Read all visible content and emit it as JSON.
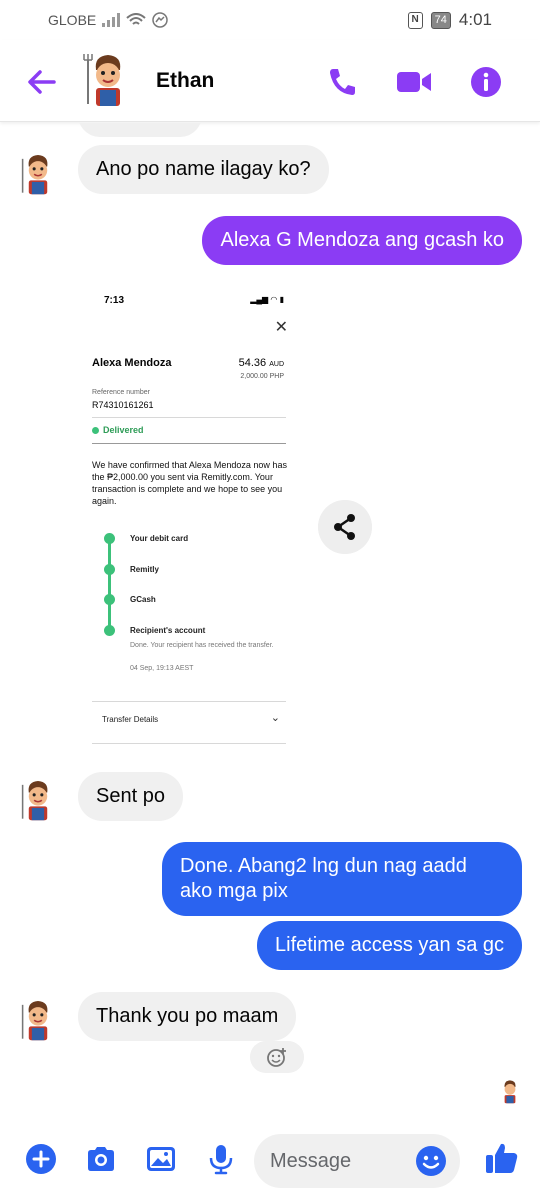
{
  "status_bar": {
    "carrier": "GLOBE",
    "battery": "74",
    "time": "4:01"
  },
  "header": {
    "contact_name": "Ethan"
  },
  "colors": {
    "accent": "#8b3cf4",
    "outgoing_blue": "#2a63f0",
    "incoming_gray": "#f0f0f0"
  },
  "messages": {
    "m1": "Ano po name ilagay ko?",
    "m2": "Alexa G Mendoza ang gcash ko",
    "m3": "Sent po",
    "m4": "Done. Abang2 lng dun nag aadd ako mga pix",
    "m5": "Lifetime access yan sa gc",
    "m6": "Thank you po maam"
  },
  "receipt": {
    "time": "7:13",
    "recipient": "Alexa Mendoza",
    "amount": "54.36",
    "currency": "AUD",
    "amount_php": "2,000.00 PHP",
    "reference_label": "Reference number",
    "reference": "R74310161261",
    "status": "Delivered",
    "confirmation": "We have confirmed that Alexa Mendoza now has the ₱2,000.00 you sent via Remitly.com. Your transaction is complete and we hope to see you again.",
    "steps": [
      "Your debit card",
      "Remitly",
      "GCash",
      "Recipient's account"
    ],
    "done_text": "Done. Your recipient has received the transfer.",
    "date": "04 Sep, 19:13 AEST",
    "transfer_details": "Transfer Details"
  },
  "composer": {
    "placeholder": "Message"
  },
  "icons": [
    "back-arrow-icon",
    "phone-icon",
    "video-icon",
    "info-icon",
    "share-icon",
    "add-reaction-icon",
    "plus-icon",
    "camera-icon",
    "gallery-icon",
    "microphone-icon",
    "emoji-icon",
    "thumbs-up-icon"
  ]
}
